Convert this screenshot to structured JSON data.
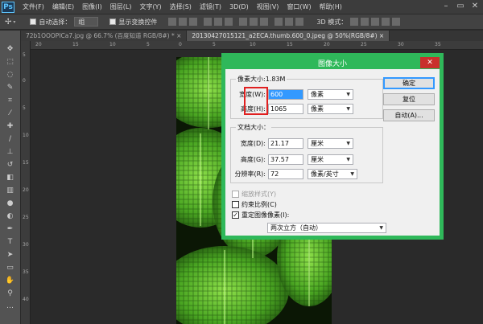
{
  "app": {
    "logo": "Ps",
    "menu": [
      "文件(F)",
      "编辑(E)",
      "图像(I)",
      "图层(L)",
      "文字(Y)",
      "选择(S)",
      "滤镜(T)",
      "3D(D)",
      "视图(V)",
      "窗口(W)",
      "帮助(H)"
    ]
  },
  "options": {
    "auto_select_label": "自动选择：",
    "auto_select_value": "组",
    "show_transform_label": "显示变换控件",
    "mode_3d_label": "3D 模式："
  },
  "tabs": [
    {
      "label": "72b1OOOPICa7.jpg @ 66.7% (百度知道  RGB/8#) *  ×"
    },
    {
      "label": "20130427015121_a2ECA.thumb.600_0.jpeg @ 50%(RGB/8#)  ×"
    }
  ],
  "ruler": {
    "h": [
      "20",
      "15",
      "10",
      "5",
      "0",
      "5",
      "10",
      "15",
      "20",
      "25",
      "30",
      "35"
    ],
    "v": [
      "5",
      "0",
      "5",
      "10",
      "15",
      "20",
      "25",
      "30",
      "35",
      "40"
    ]
  },
  "dialog": {
    "title": "图像大小",
    "close": "✕",
    "pixel_group": {
      "label": "像素大小:1.83M",
      "width_label": "宽度(W):",
      "width_value": "600",
      "width_unit": "像素",
      "height_label": "高度(H):",
      "height_value": "1065",
      "height_unit": "像素"
    },
    "doc_group": {
      "label": "文档大小：",
      "width_label": "宽度(D):",
      "width_value": "21.17",
      "width_unit": "厘米",
      "height_label": "高度(G):",
      "height_value": "37.57",
      "height_unit": "厘米",
      "res_label": "分辨率(R):",
      "res_value": "72",
      "res_unit": "像素/英寸"
    },
    "scale_styles": "缩放样式(Y)",
    "constrain": "约束比例(C)",
    "resample": "重定图像像素(I):",
    "resample_method": "两次立方（自动）",
    "buttons": {
      "ok": "确定",
      "reset": "复位",
      "auto": "自动(A)..."
    }
  },
  "colors": {
    "dialog_border": "#2fb85a",
    "highlight": "#e02020",
    "selection": "#3399ff"
  }
}
